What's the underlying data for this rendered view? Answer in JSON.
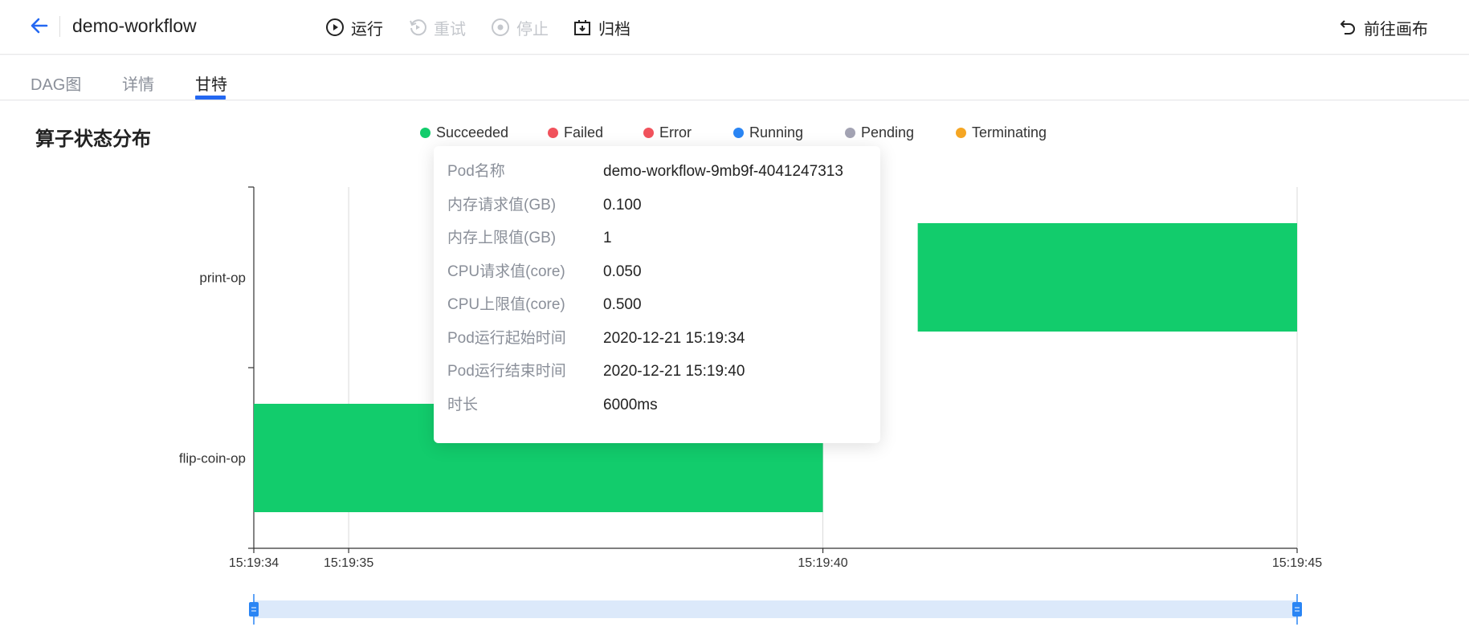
{
  "header": {
    "title": "demo-workflow",
    "actions": [
      {
        "label": "运行",
        "enabled": true,
        "icon": "play-circle-icon"
      },
      {
        "label": "重试",
        "enabled": false,
        "icon": "retry-icon"
      },
      {
        "label": "停止",
        "enabled": false,
        "icon": "stop-circle-icon"
      },
      {
        "label": "归档",
        "enabled": true,
        "icon": "archive-icon"
      }
    ],
    "right_action": {
      "label": "前往画布",
      "icon": "undo-arrow-icon"
    }
  },
  "tabs": [
    {
      "label": "DAG图",
      "active": false
    },
    {
      "label": "详情",
      "active": false
    },
    {
      "label": "甘特",
      "active": true
    }
  ],
  "section_title": "算子状态分布",
  "legend": [
    {
      "label": "Succeeded",
      "color": "#12cc6c"
    },
    {
      "label": "Failed",
      "color": "#f1525c"
    },
    {
      "label": "Error",
      "color": "#f1525c"
    },
    {
      "label": "Running",
      "color": "#2a85f4"
    },
    {
      "label": "Pending",
      "color": "#a3a3b3"
    },
    {
      "label": "Terminating",
      "color": "#f5a623"
    }
  ],
  "chart_data": {
    "type": "gantt",
    "categories": [
      "print-op",
      "flip-coin-op"
    ],
    "x_ticks": [
      "15:19:34",
      "15:19:35",
      "15:19:40",
      "15:19:45"
    ],
    "x_range_seconds": [
      "15:19:34",
      "15:19:45"
    ],
    "bars": [
      {
        "name": "print-op",
        "start": "15:19:41",
        "end": "15:19:45",
        "status": "Succeeded"
      },
      {
        "name": "flip-coin-op",
        "start": "15:19:34",
        "end": "15:19:40",
        "status": "Succeeded"
      }
    ],
    "bar_color": "#12cc6c",
    "grid": true
  },
  "tooltip": {
    "rows": [
      {
        "key": "Pod名称",
        "value": "demo-workflow-9mb9f-4041247313"
      },
      {
        "key": "内存请求值(GB)",
        "value": "0.100"
      },
      {
        "key": "内存上限值(GB)",
        "value": "1"
      },
      {
        "key": "CPU请求值(core)",
        "value": "0.050"
      },
      {
        "key": "CPU上限值(core)",
        "value": "0.500"
      },
      {
        "key": "Pod运行起始时间",
        "value": "2020-12-21 15:19:34"
      },
      {
        "key": "Pod运行结束时间",
        "value": "2020-12-21 15:19:40"
      },
      {
        "key": "时长",
        "value": "6000ms"
      }
    ]
  },
  "slider": {
    "start": 0,
    "end": 1
  }
}
